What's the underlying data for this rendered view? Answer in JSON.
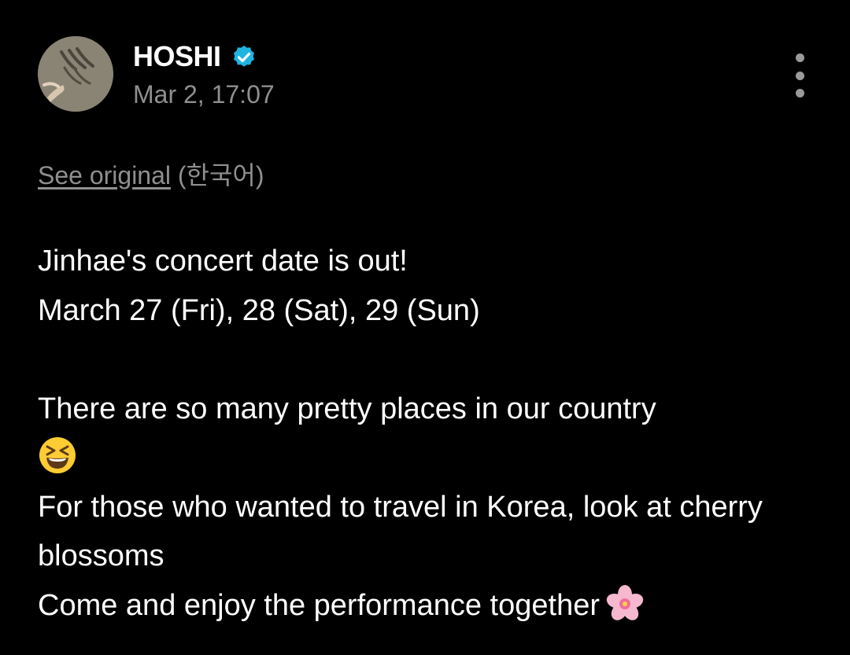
{
  "post": {
    "author": {
      "name": "HOSHI",
      "verified": true,
      "avatar_icon": "avatar-photo"
    },
    "timestamp": "Mar 2, 17:07",
    "more_icon": "more-vertical-icon",
    "translation": {
      "see_original_label": "See original",
      "language": "(한국어)"
    },
    "body": {
      "line1": "Jinhae's concert date is out!",
      "line2": "March 27 (Fri), 28 (Sat), 29 (Sun)",
      "line3": "There are so many pretty places in our country",
      "line3_emoji": "grinning-squinting-face-emoji",
      "line4": "For those who wanted to travel in Korea, look at cherry blossoms",
      "line5": "Come and enjoy the performance together",
      "line5_emoji": "cherry-blossom-emoji"
    }
  },
  "colors": {
    "background": "#000000",
    "text": "#ffffff",
    "muted": "#8f8f8f",
    "verified_badge": "#1fb4e0"
  }
}
